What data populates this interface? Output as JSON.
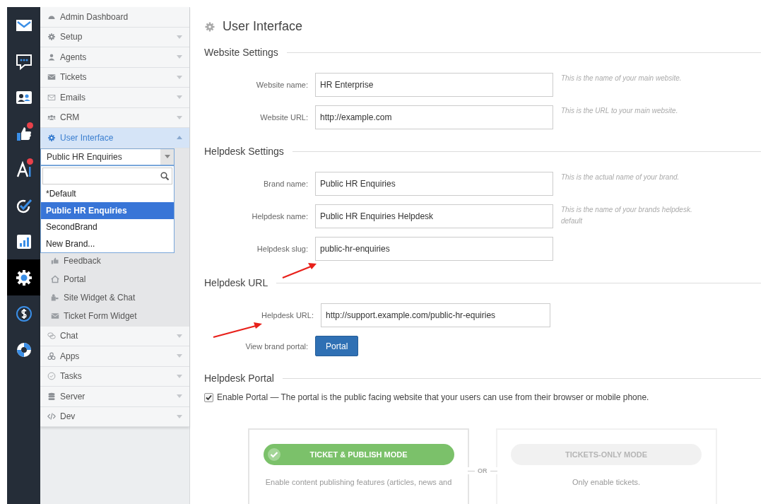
{
  "rail": [
    {
      "kind": "mail",
      "selected": false,
      "badge": false
    },
    {
      "kind": "chat",
      "selected": false,
      "badge": false
    },
    {
      "kind": "contacts",
      "selected": false,
      "badge": false
    },
    {
      "kind": "thumb",
      "selected": false,
      "badge": true
    },
    {
      "kind": "letter",
      "selected": false,
      "badge": true
    },
    {
      "kind": "check",
      "selected": false,
      "badge": false
    },
    {
      "kind": "chart",
      "selected": false,
      "badge": false
    },
    {
      "kind": "gear",
      "selected": true,
      "badge": false
    },
    {
      "kind": "dollar",
      "selected": false,
      "badge": false
    },
    {
      "kind": "lifebuoy",
      "selected": false,
      "badge": false
    }
  ],
  "sidebar": {
    "items": [
      {
        "kind": "link",
        "label": "Admin Dashboard",
        "selected": false,
        "expanded": false
      },
      {
        "kind": "group",
        "label": "Setup",
        "selected": false,
        "expanded": false
      },
      {
        "kind": "group",
        "label": "Agents",
        "selected": false,
        "expanded": false
      },
      {
        "kind": "group",
        "label": "Tickets",
        "selected": false,
        "expanded": false
      },
      {
        "kind": "group",
        "label": "Emails",
        "selected": false,
        "expanded": false
      },
      {
        "kind": "group",
        "label": "CRM",
        "selected": false,
        "expanded": false
      },
      {
        "kind": "group",
        "label": "User Interface",
        "selected": true,
        "expanded": true,
        "brand_select": {
          "value": "Public HR Enquiries",
          "options": [
            {
              "label": "*Default",
              "selected": false
            },
            {
              "label": "Public HR Enquiries",
              "selected": true
            },
            {
              "label": "SecondBrand",
              "selected": false
            },
            {
              "label": "New Brand...",
              "selected": false
            }
          ]
        },
        "children": [
          {
            "label": "Feedback"
          },
          {
            "label": "Portal"
          },
          {
            "label": "Site Widget & Chat"
          },
          {
            "label": "Ticket Form Widget"
          }
        ]
      },
      {
        "kind": "group",
        "label": "Chat",
        "selected": false,
        "expanded": false
      },
      {
        "kind": "group",
        "label": "Apps",
        "selected": false,
        "expanded": false
      },
      {
        "kind": "group",
        "label": "Tasks",
        "selected": false,
        "expanded": false
      },
      {
        "kind": "group",
        "label": "Server",
        "selected": false,
        "expanded": false
      },
      {
        "kind": "group",
        "label": "Dev",
        "selected": false,
        "expanded": false
      }
    ]
  },
  "main": {
    "title": "User Interface",
    "sections": [
      {
        "title": "Website Settings",
        "rows": [
          {
            "kind": "input",
            "label": "Website name:",
            "value": "HR Enterprise",
            "hint": [
              "This is the name of your main website."
            ]
          },
          {
            "kind": "input",
            "label": "Website URL:",
            "value": "http://example.com",
            "hint": [
              "This is the URL to your main website."
            ]
          }
        ]
      },
      {
        "title": "Helpdesk Settings",
        "rows": [
          {
            "kind": "input",
            "label": "Brand name:",
            "value": "Public HR Enquiries",
            "hint": [
              "This is the actual name of your brand."
            ]
          },
          {
            "kind": "input",
            "label": "Helpdesk name:",
            "value": "Public HR Enquiries Helpdesk",
            "hint": [
              "This is the name of your brands helpdesk.",
              "default"
            ]
          },
          {
            "kind": "input",
            "label": "Helpdesk slug:",
            "value": "public-hr-enquiries"
          }
        ]
      },
      {
        "title": "Helpdesk URL",
        "rows": [
          {
            "kind": "input",
            "label": "Helpdesk URL:",
            "value": "http://support.example.com/public-hr-equiries"
          },
          {
            "kind": "button",
            "label": "View brand portal:",
            "value": "Portal"
          }
        ]
      },
      {
        "title": "Helpdesk Portal",
        "rows": [
          {
            "kind": "checkbox",
            "label": "Enable Portal — The portal is the public facing website that your users can use from their browser or mobile phone.",
            "checked": true
          }
        ]
      }
    ],
    "modes": {
      "or_label": "OR",
      "items": [
        {
          "title": "TICKET & PUBLISH MODE",
          "selected": true,
          "description": "Enable content publishing features (articles, news and"
        },
        {
          "title": "TICKETS-ONLY MODE",
          "selected": false,
          "description": "Only enable tickets."
        }
      ]
    }
  }
}
